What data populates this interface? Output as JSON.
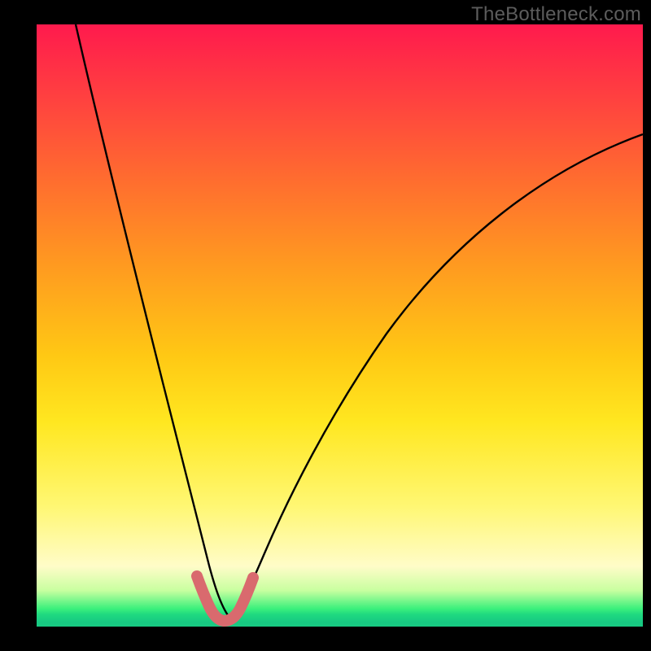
{
  "watermark": "TheBottleneck.com",
  "chart_data": {
    "type": "line",
    "title": "",
    "xlabel": "",
    "ylabel": "",
    "xlim": [
      0,
      100
    ],
    "ylim": [
      0,
      100
    ],
    "series": [
      {
        "name": "bottleneck-curve",
        "x": [
          0,
          5,
          10,
          15,
          18,
          22,
          25,
          27,
          28.5,
          30,
          32,
          33.5,
          35,
          38,
          42,
          50,
          60,
          70,
          80,
          90,
          100
        ],
        "y": [
          100,
          80,
          60,
          40,
          28,
          15,
          6,
          2,
          0.5,
          0,
          0.5,
          2,
          5,
          12,
          22,
          40,
          56,
          67,
          75,
          80,
          84
        ]
      },
      {
        "name": "optimal-marker",
        "x": [
          25,
          27,
          28.5,
          30,
          31.5,
          33,
          35
        ],
        "y": [
          6,
          2,
          0.5,
          0,
          0.5,
          2,
          6
        ]
      }
    ],
    "gradient_bands": [
      {
        "color": "#ff1a4d",
        "pos": 0
      },
      {
        "color": "#ffc814",
        "pos": 55
      },
      {
        "color": "#fffcc8",
        "pos": 90
      },
      {
        "color": "#18ca82",
        "pos": 100
      }
    ]
  }
}
